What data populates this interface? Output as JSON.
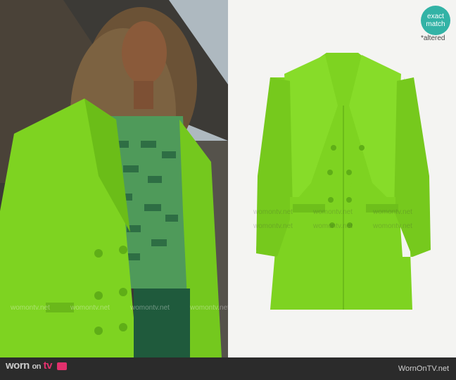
{
  "badge": {
    "line1": "exact",
    "line2": "match",
    "note": "*altered"
  },
  "watermark": "womontv.net",
  "footer": {
    "logo_main": "worn",
    "logo_sub": "on",
    "logo_tv": "tv",
    "site": "WornOnTV.net"
  },
  "colors": {
    "blazer_green": "#7ed321",
    "sweater_green": "#4f9a5a",
    "badge_teal": "#33b3a6",
    "footer_bg": "#2b2b2b"
  }
}
